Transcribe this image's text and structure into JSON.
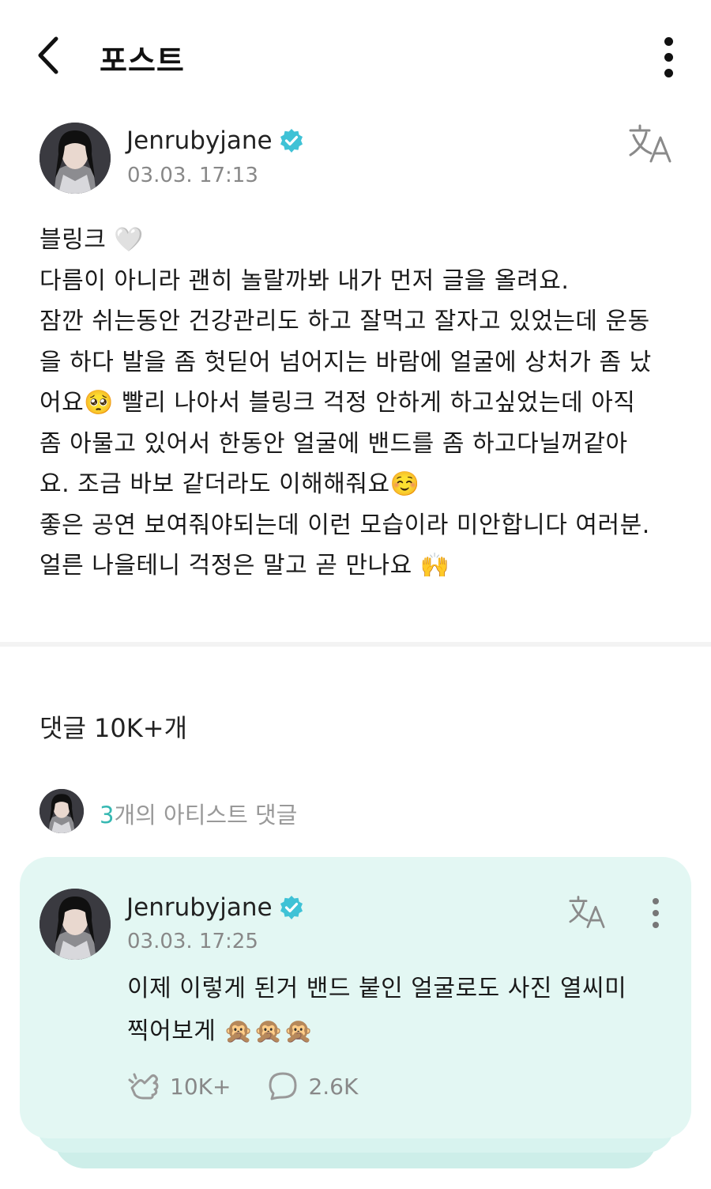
{
  "header": {
    "title": "포스트",
    "back_icon": "chevron-left-icon",
    "more_icon": "more-vertical-icon"
  },
  "post": {
    "author": "Jenrubyjane",
    "verified": true,
    "date": "03.03. 17:13",
    "translate_icon": "translate-icon",
    "lines": [
      "블링크 🤍",
      "다름이 아니라 괜히 놀랄까봐 내가 먼저 글을 올려요.",
      "잠깐 쉬는동안 건강관리도 하고 잘먹고 잘자고 있었는데 운동",
      "을 하다 발을 좀 헛딛어 넘어지는 바람에 얼굴에 상처가 좀 났",
      "어요🥺 빨리 나아서 블링크 걱정 안하게 하고싶었는데 아직",
      "좀 아물고 있어서 한동안 얼굴에 밴드를 좀 하고다닐꺼같아",
      "요. 조금 바보 같더라도 이해해줘요☺️",
      "좋은 공연 보여줘야되는데 이런 모습이라 미안합니다 여러분.",
      "얼른 나을테니 걱정은 말고 곧 만나요 🙌"
    ]
  },
  "comments": {
    "count_label": "댓글 10K+개",
    "artist_count": "3",
    "artist_label_suffix": "개의 아티스트 댓글"
  },
  "artist_comment": {
    "author": "Jenrubyjane",
    "date": "03.03. 17:25",
    "lines": [
      "이제 이렇게 된거 밴드 붙인 얼굴로도 사진 열씨미",
      "찍어보게 🙊🙊🙊"
    ],
    "like_count": "10K+",
    "reply_count": "2.6K",
    "like_icon": "cheer-hand-icon",
    "reply_icon": "speech-bubble-icon"
  },
  "colors": {
    "accent_teal": "#36b8b2",
    "verified_blue": "#3fc2d6",
    "card_bg": "#e3f7f3"
  }
}
